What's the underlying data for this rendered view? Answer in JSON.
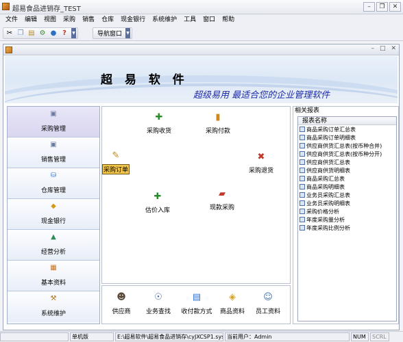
{
  "window": {
    "title": "超易食品进销存_TEST"
  },
  "menu": [
    "文件",
    "编辑",
    "视图",
    "采购",
    "销售",
    "仓库",
    "现金银行",
    "系统维护",
    "工具",
    "窗口",
    "帮助"
  ],
  "toolbar": {
    "nav_label": "导航窗口"
  },
  "banner": {
    "brand": "超 易 软 件",
    "slogan": "超级易用 最适合您的企业管理软件"
  },
  "sidebar": {
    "items": [
      {
        "label": "采购管理",
        "icon": "cart-icon"
      },
      {
        "label": "销售管理",
        "icon": "sales-icon"
      },
      {
        "label": "仓库管理",
        "icon": "warehouse-icon"
      },
      {
        "label": "现金银行",
        "icon": "cash-icon"
      },
      {
        "label": "经营分析",
        "icon": "chart-icon"
      },
      {
        "label": "基本资料",
        "icon": "database-icon"
      },
      {
        "label": "系统维护",
        "icon": "tools-icon"
      }
    ]
  },
  "workspace": {
    "items": [
      {
        "label": "采购收货",
        "icon": "receive-icon"
      },
      {
        "label": "采购付款",
        "icon": "payment-icon"
      },
      {
        "label": "采购订单",
        "icon": "order-icon"
      },
      {
        "label": "采购退货",
        "icon": "return-icon"
      },
      {
        "label": "估价入库",
        "icon": "estimate-icon"
      },
      {
        "label": "现款采购",
        "icon": "cash-purchase-icon"
      }
    ]
  },
  "bottom": {
    "items": [
      {
        "label": "供应商",
        "icon": "supplier-icon"
      },
      {
        "label": "业务查找",
        "icon": "search-icon"
      },
      {
        "label": "收付款方式",
        "icon": "payment-method-icon"
      },
      {
        "label": "商品资料",
        "icon": "product-icon"
      },
      {
        "label": "员工资料",
        "icon": "staff-icon"
      }
    ]
  },
  "reports": {
    "title": "相关报表",
    "header": "报表名称",
    "items": [
      "商品采购订单汇总表",
      "商品采购订单明细表",
      "供应商供货汇总表(按币种合并)",
      "供应商供货汇总表(按币种分开)",
      "供应商供货汇总表",
      "供应商供货明细表",
      "商品采购汇总表",
      "商品采购明细表",
      "业务员采购汇总表",
      "业务员采购明细表",
      "采购价格分析",
      "年度采购量分析",
      "年度采购比例分析"
    ]
  },
  "status": {
    "mode": "单机版",
    "path": "E:\\超易软件\\超易食品进销存\\cyJXCSP1.sys",
    "user": "当前用户：Admin",
    "num": "NUM",
    "scrl": "SCRL"
  }
}
